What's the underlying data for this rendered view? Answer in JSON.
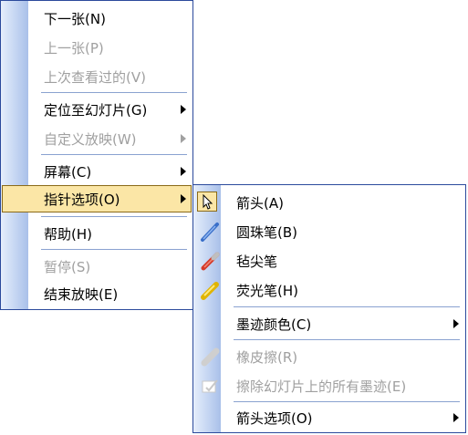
{
  "menu1": {
    "next": "下一张(N)",
    "prev": "上一张(P)",
    "last_viewed": "上次查看过的(V)",
    "goto_slide": "定位至幻灯片(G)",
    "custom_show": "自定义放映(W)",
    "screen": "屏幕(C)",
    "pointer_options": "指针选项(O)",
    "help": "帮助(H)",
    "pause": "暂停(S)",
    "end_show": "结束放映(E)"
  },
  "menu2": {
    "arrow": "箭头(A)",
    "ballpoint": "圆珠笔(B)",
    "felt_tip": "毡尖笔",
    "highlighter": "荧光笔(H)",
    "ink_color": "墨迹颜色(C)",
    "eraser": "橡皮擦(R)",
    "erase_all": "擦除幻灯片上的所有墨迹(E)",
    "arrow_options": "箭头选项(O)"
  },
  "icons": {
    "arrow": "pointer-arrow-icon",
    "ballpoint": "ballpoint-pen-icon",
    "felt_tip": "felt-tip-pen-icon",
    "highlighter": "highlighter-icon",
    "eraser": "eraser-icon",
    "erase_all": "erase-all-ink-icon"
  },
  "colors": {
    "menu_border": "#2b4a9c",
    "highlight_bg": "#fbe6a6",
    "highlight_border": "#8a6a18",
    "disabled_text": "#a0a0a0"
  }
}
